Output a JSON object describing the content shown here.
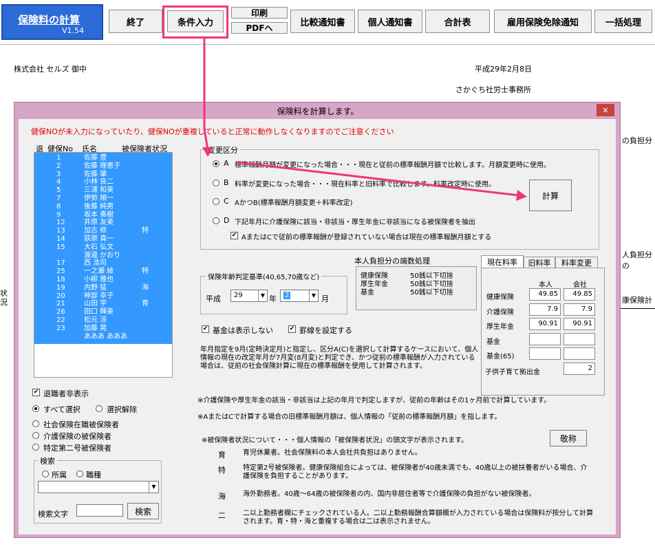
{
  "toolbar": {
    "logo_title": "保険料の計算",
    "logo_version": "V1.54",
    "end": "終了",
    "conditions": "条件入力",
    "print": "印刷",
    "pdf": "PDFへ",
    "compare": "比較通知書",
    "individual": "個人通知書",
    "total": "合計表",
    "employment": "雇用保険免除通知",
    "batch": "一括処理"
  },
  "header": {
    "company": "株式会社 セルズ 御中",
    "date": "平成29年2月8日",
    "office": "さかぐち社労士事務所"
  },
  "background": {
    "right1": "の負担分",
    "right2": "人負担分の",
    "right3": "康保険計",
    "left": "状\n況"
  },
  "dialog": {
    "title": "保険料を計算します。",
    "close": "×",
    "warning": "健保NOが未入力になっていたり、健保NOが重複していると正常に動作しなくなりますのでご注意ください",
    "list_headers": [
      "退",
      "健保No",
      "氏名",
      "被保険者状況"
    ],
    "employees": [
      {
        "no": "1",
        "name": "佐藤 豊",
        "status": ""
      },
      {
        "no": "2",
        "name": "佐藤 理恵子",
        "status": ""
      },
      {
        "no": "3",
        "name": "佐藤 肇",
        "status": ""
      },
      {
        "no": "4",
        "name": "小林 良二",
        "status": ""
      },
      {
        "no": "5",
        "name": "三浦 和美",
        "status": ""
      },
      {
        "no": "7",
        "name": "伊勢 順一",
        "status": ""
      },
      {
        "no": "8",
        "name": "後藤 純男",
        "status": ""
      },
      {
        "no": "9",
        "name": "坂本 奏樹",
        "status": ""
      },
      {
        "no": "12",
        "name": "井原 友美",
        "status": ""
      },
      {
        "no": "13",
        "name": "加古 修",
        "status": "特"
      },
      {
        "no": "14",
        "name": "荻原 真一",
        "status": ""
      },
      {
        "no": "15",
        "name": "大石 弘文",
        "status": ""
      },
      {
        "no": "",
        "name": "渡邊 かおり",
        "status": ""
      },
      {
        "no": "17",
        "name": "西 浩司",
        "status": ""
      },
      {
        "no": "25",
        "name": "一之瀬 綾",
        "status": "特"
      },
      {
        "no": "18",
        "name": "小柳 雅也",
        "status": ""
      },
      {
        "no": "19",
        "name": "内野 猛",
        "status": "海"
      },
      {
        "no": "20",
        "name": "神部 幸子",
        "status": ""
      },
      {
        "no": "21",
        "name": "山田 学",
        "status": "育"
      },
      {
        "no": "26",
        "name": "田口 輝美",
        "status": ""
      },
      {
        "no": "22",
        "name": "松元 涼",
        "status": ""
      },
      {
        "no": "23",
        "name": "加藤 晃",
        "status": ""
      },
      {
        "no": "",
        "name": "あああ あああ",
        "status": ""
      }
    ],
    "retired_hide": "退職者非表示",
    "select_all": "すべて選択",
    "deselect": "選択解除",
    "filter": [
      "社会保険在職被保険者",
      "介護保険の被保険者",
      "特定第二号被保険者"
    ],
    "search_legend": "検索",
    "search_opts": [
      "所属",
      "職種"
    ],
    "search_text_label": "検索文字",
    "search_button": "検索",
    "change_legend": "変更区分",
    "options": [
      {
        "key": "A",
        "text": "標準報酬月額が変更になった場合・・・現在と従前の標準報酬月額で比較します。月額変更時に使用。"
      },
      {
        "key": "B",
        "text": "料率が変更になった場合・・・現在料率と旧料率で比較します。料率改定時に使用。"
      },
      {
        "key": "C",
        "text": "AかつB(標準報酬月額変更＋料率改定)"
      },
      {
        "key": "D",
        "text": "下記年月に介護保険に該当・非該当・厚生年金に非該当になる被保険者を抽出"
      }
    ],
    "option_check": "AまたはCで従前の標準報酬が登録されていない場合は現在の標準報酬月額とする",
    "calc_button": "計算",
    "age_legend": "保険年齢判定基準(40,65,70歳など)",
    "era": "平成",
    "year": "29",
    "year_unit": "年",
    "month": "2",
    "month_unit": "月",
    "fraction_title": "本人負担分の端数処理",
    "fractions": [
      {
        "label": "健康保険",
        "rule": "50銭以下切捨"
      },
      {
        "label": "厚生年金",
        "rule": "50銭以下切捨"
      },
      {
        "label": "基金",
        "rule": "50銭以下切捨"
      }
    ],
    "kikin_hide": "基金は表示しない",
    "grid_lines": "罫線を設定する",
    "tabs": [
      "現在料率",
      "旧料率",
      "料率変更"
    ],
    "rate_headers": [
      "本人",
      "会社"
    ],
    "rates": [
      {
        "label": "健康保険",
        "self": "49.85",
        "company": "49.85"
      },
      {
        "label": "介護保険",
        "self": "7.9",
        "company": "7.9"
      },
      {
        "label": "厚生年金",
        "self": "90.91",
        "company": "90.91"
      },
      {
        "label": "基金",
        "self": "",
        "company": ""
      },
      {
        "label": "基金(65)",
        "self": "",
        "company": ""
      }
    ],
    "child_label": "子供子育て拠出金",
    "child_value": "2",
    "note_para": "年月指定を9月(定時決定月)と指定し、区分A(C)を選択して計算するケースにおいて、個人情報の現在の改定年月が7月変(8月変)と判定でき、かつ従前の標準報酬が入力されている場合は、従前の社会保険計算に現在の標準報酬を使用して計算されます。",
    "note1": "※介護保険や厚生年金の該当・非該当は上記の年月で判定しますが、従前の年齢はその1ヶ月前で計算しています。",
    "note2": "※AまたはCで計算する場合の旧標準報酬月額は、個人情報の「従前の標準報酬月額」を指します。",
    "note3": "※被保険者状況について・・・個人情報の「被保険者状況」の頭文字が表示されます。",
    "honorific_button": "敬称",
    "legend_items": [
      {
        "mark": "育",
        "text": "育児休業者。社会保険料の本人会社共負担はありません。"
      },
      {
        "mark": "特",
        "text": "特定第2号被保険者。健康保険組合によっては、被保険者が40歳未満でも、40歳以上の被扶養者がいる場合、介護保険を負担することがあります。"
      },
      {
        "mark": "海",
        "text": "海外勤務者。40歳～64歳の被保険者の内、国内非居住者等で介護保険の負担がない被保険者。"
      },
      {
        "mark": "二",
        "text": "二以上勤務者欄にチェックされている人。二以上勤務報酬合算額欄が入力されている場合は保険料が按分して計算されます。育・特・海と重複する場合は二は表示されません。"
      }
    ]
  },
  "colors": {
    "logo": "#2a6bd8",
    "highlight": "#f0357d",
    "dialog_frame": "#d7a5c6",
    "selection": "#3399ff",
    "warning": "#e00000"
  }
}
